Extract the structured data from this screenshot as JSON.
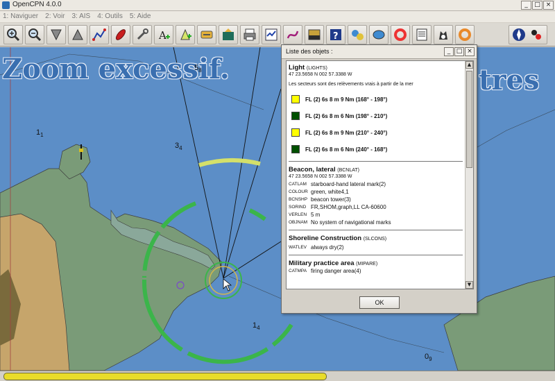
{
  "window": {
    "title": "OpenCPN 4.0.0",
    "controls": [
      "_",
      "□",
      "×"
    ]
  },
  "menu": [
    "1: Naviguer",
    "2: Voir",
    "3: AIS",
    "4: Outils",
    "5: Aide"
  ],
  "toolbar": {
    "icons": [
      "zoom-in-icon",
      "zoom-out-icon",
      "scale-down-icon",
      "scale-up-icon",
      "route-icon",
      "tracking-icon",
      "settings-icon",
      "text-icon",
      "mark-icon",
      "anchor-icon",
      "chart-pan-icon",
      "print-icon",
      "route-manager-icon",
      "track-icon",
      "tide-icon",
      "help-icon",
      "settings2-icon",
      "ais-icon",
      "man-overboard-icon",
      "log-icon",
      "dog-icon",
      "lifebuoy-icon"
    ]
  },
  "chart": {
    "zoom_message": "Zoom excessif.",
    "right_fragment": "tres",
    "depths": [
      {
        "main": "5",
        "sub": "8"
      },
      {
        "main": "1",
        "sub": "1"
      },
      {
        "main": "3",
        "sub": "4"
      },
      {
        "main": "1",
        "sub": "4"
      },
      {
        "main": "0",
        "sub": "9"
      }
    ],
    "colors": {
      "sea": "#5c8ec7",
      "land": "#c6a56b",
      "shallow": "#7a9b78",
      "ring": "#3bb54a",
      "light_yellow": "#d4e06a"
    }
  },
  "dialog": {
    "title": "Liste des objets :",
    "buttons": [
      "_",
      "□",
      "×"
    ],
    "light": {
      "name": "Light",
      "acronym": "(LIGHTS)",
      "coords": "47 23.5658 N 002 57.3388 W",
      "note": "Les secteurs sont des relèvements vrais à partir de la mer",
      "sectors": [
        {
          "color": "#ffff00",
          "text": "FL (2) 6s 8 m 9 Nm (168° - 198°)"
        },
        {
          "color": "#005000",
          "text": "FL (2) 6s 8 m 6 Nm (198° - 210°)"
        },
        {
          "color": "#ffff00",
          "text": "FL (2) 6s 8 m 9 Nm (210° - 240°)"
        },
        {
          "color": "#005000",
          "text": "FL (2) 6s 8 m 6 Nm (240° - 168°)"
        }
      ]
    },
    "beacon": {
      "name": "Beacon, lateral",
      "acronym": "(BCNLAT)",
      "coords": "47 23.5658 N 002 57.3388 W",
      "attrs": [
        {
          "k": "CATLAM",
          "v": "starboard-hand lateral mark(2)"
        },
        {
          "k": "COLOUR",
          "v": "green, white4,1"
        },
        {
          "k": "BCNSHP",
          "v": "beacon tower(3)"
        },
        {
          "k": "SORIND",
          "v": "FR,SHOM,graph,LL CA-60600"
        },
        {
          "k": "VERLEN",
          "v": "5 m"
        },
        {
          "k": "OBJNAM",
          "v": "No system of navigational marks"
        }
      ]
    },
    "shoreline": {
      "name": "Shoreline Construction",
      "acronym": "(SLCONS)",
      "attrs": [
        {
          "k": "WATLEV",
          "v": "always dry(2)"
        }
      ]
    },
    "military": {
      "name": "Military practice area",
      "acronym": "(MIPARE)",
      "attrs": [
        {
          "k": "CATMPA",
          "v": "firing danger area(4)"
        }
      ]
    },
    "ok_label": "OK"
  },
  "status": {
    "progress": 0.59
  }
}
